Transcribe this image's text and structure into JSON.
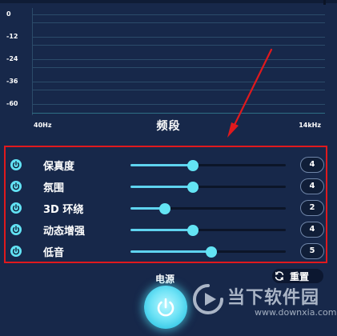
{
  "graph": {
    "y_labels": [
      "0",
      "-12",
      "-24",
      "-36",
      "-60"
    ],
    "x_left": "40Hz",
    "x_title": "频段",
    "x_right": "14kHz"
  },
  "controls": [
    {
      "label": "保真度",
      "value": "4",
      "level": 0.4
    },
    {
      "label": "氛围",
      "value": "4",
      "level": 0.4
    },
    {
      "label": "3D 环绕",
      "value": "2",
      "level": 0.22
    },
    {
      "label": "动态增强",
      "value": "4",
      "level": 0.4
    },
    {
      "label": "低音",
      "value": "5",
      "level": 0.52
    }
  ],
  "power": {
    "label": "电源",
    "icon": "power-icon"
  },
  "reset": {
    "label": "重置",
    "icon": "refresh-icon"
  },
  "watermark": {
    "brand": "当下软件园",
    "url": "www.downxia.com"
  },
  "colors": {
    "background": "#17284a",
    "accent": "#63e4f4",
    "annotation": "#e0191d"
  }
}
